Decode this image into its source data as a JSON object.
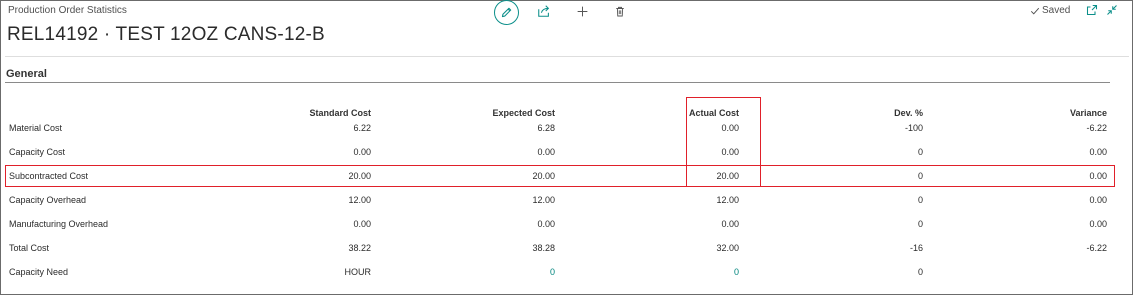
{
  "window": {
    "caption": "Production Order Statistics",
    "status": "Saved",
    "icons": [
      "edit-icon",
      "share-icon",
      "add-icon",
      "delete-icon",
      "check-icon",
      "open-new-window-icon",
      "collapse-icon"
    ]
  },
  "page": {
    "title": "REL14192 · TEST 12OZ CANS-12-B",
    "section": "General"
  },
  "table": {
    "columns": [
      "",
      "Standard Cost",
      "Expected Cost",
      "Actual Cost",
      "Dev. %",
      "Variance"
    ],
    "rows": [
      [
        "Material Cost",
        "6.22",
        "6.28",
        "0.00",
        "-100",
        "-6.22"
      ],
      [
        "Capacity Cost",
        "0.00",
        "0.00",
        "0.00",
        "0",
        "0.00"
      ],
      [
        "Subcontracted Cost",
        "20.00",
        "20.00",
        "20.00",
        "0",
        "0.00"
      ],
      [
        "Capacity Overhead",
        "12.00",
        "12.00",
        "12.00",
        "0",
        "0.00"
      ],
      [
        "Manufacturing Overhead",
        "0.00",
        "0.00",
        "0.00",
        "0",
        "0.00"
      ],
      [
        "Total Cost",
        "38.22",
        "38.28",
        "32.00",
        "-16",
        "-6.22"
      ],
      [
        "Capacity Need",
        "HOUR",
        "0",
        "0",
        "0",
        ""
      ]
    ]
  },
  "colors": {
    "accent": "#00857d",
    "highlight": "#e0202a",
    "text": "#212121"
  }
}
